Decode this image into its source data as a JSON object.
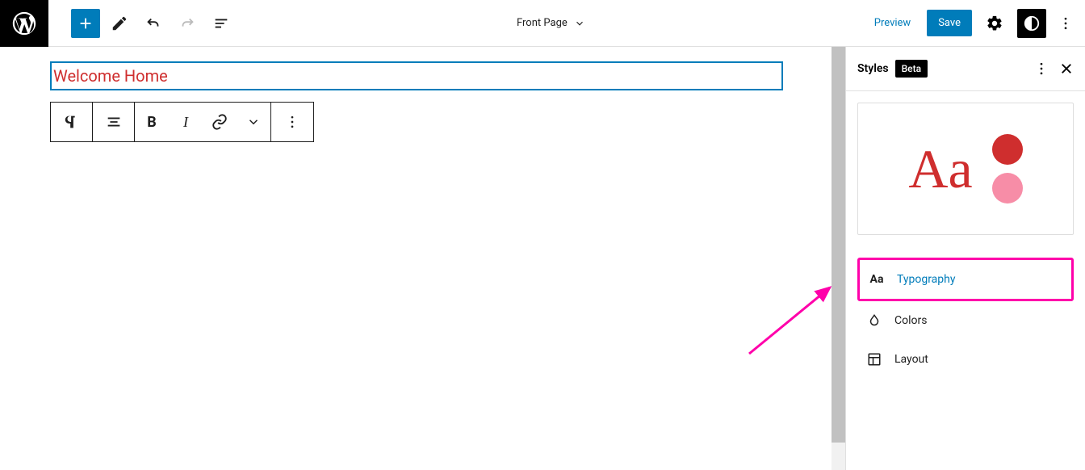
{
  "topbar": {
    "page_title": "Front Page",
    "preview_label": "Preview",
    "save_label": "Save"
  },
  "editor": {
    "heading_text": "Welcome Home"
  },
  "sidebar": {
    "title": "Styles",
    "badge": "Beta",
    "preview_text": "Aa",
    "items": [
      {
        "label": "Typography"
      },
      {
        "label": "Colors"
      },
      {
        "label": "Layout"
      }
    ]
  },
  "colors": {
    "accent": "#007cba",
    "heading": "#cf2e2e",
    "swatch1": "#cf2e2e",
    "swatch2": "#f78da7",
    "highlight": "#ff00aa"
  }
}
